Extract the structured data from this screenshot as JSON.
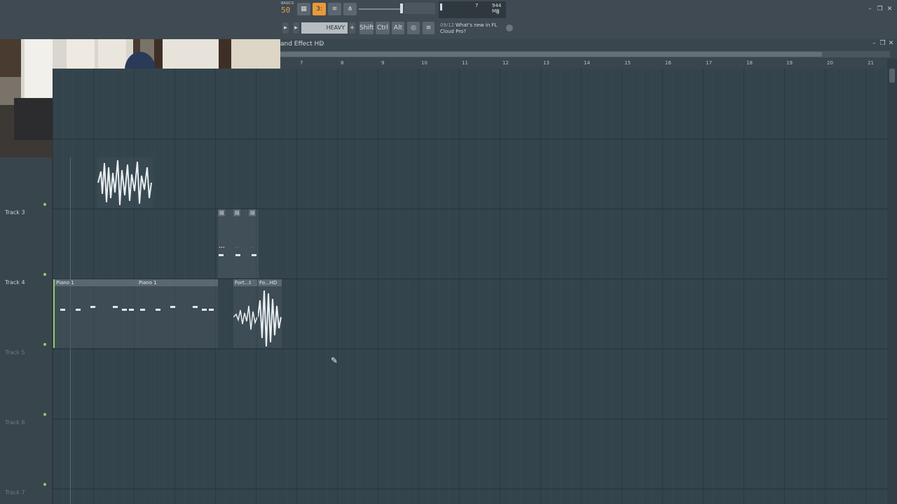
{
  "toolbar": {
    "tempo_fragment": "50",
    "tempo_top": "BASICS",
    "cpu_value": "7",
    "memory": "944 MB",
    "polyphony": "0",
    "pattern_label": "HEAVY",
    "shift_label": "Shift",
    "ctrl_label": "Ctrl",
    "alt_label": "Alt",
    "news_date": "09/12",
    "news_line1": "What's new in FL",
    "news_line2": "Cloud Pro?"
  },
  "playlist": {
    "title": "and Effect HD",
    "ruler": [
      "7",
      "8",
      "9",
      "10",
      "11",
      "12",
      "13",
      "14",
      "15",
      "16",
      "17",
      "18",
      "19",
      "20",
      "21"
    ]
  },
  "tracks": [
    {
      "label": "Track 3"
    },
    {
      "label": "Track 4"
    },
    {
      "label": "Track 5"
    },
    {
      "label": "Track 6"
    },
    {
      "label": "Track 7"
    }
  ],
  "clips": {
    "piano1_a": "Piano 1",
    "piano1_b": "Piano 1",
    "fort_a": "Fort...t",
    "fort_b": "Fo...HD"
  },
  "colors": {
    "accent": "#e89a3c",
    "grid_bg": "#34444d",
    "track_dot": "#8fd06b"
  }
}
